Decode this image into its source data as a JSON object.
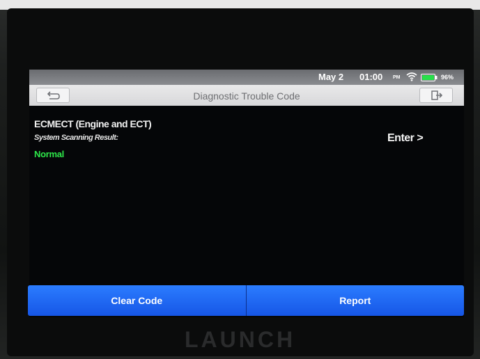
{
  "statusbar": {
    "date": "May 2",
    "time": "01:00",
    "ampm": "PM",
    "battery": "96%",
    "wifi_icon": "wifi-icon",
    "battery_icon": "battery-icon",
    "battery_color": "#28e04a"
  },
  "header": {
    "title": "Diagnostic Trouble Code",
    "back_icon": "back-arrow-icon",
    "exit_icon": "exit-icon"
  },
  "system": {
    "name": "ECMECT (Engine and ECT)",
    "scan_label": "System Scanning Result:",
    "scan_status": "Normal",
    "status_color": "#2ee84a",
    "enter_label": "Enter >"
  },
  "footer": {
    "clear_label": "Clear Code",
    "report_label": "Report",
    "accent_color": "#1f6cf5"
  },
  "device": {
    "brand": "LAUNCH"
  }
}
